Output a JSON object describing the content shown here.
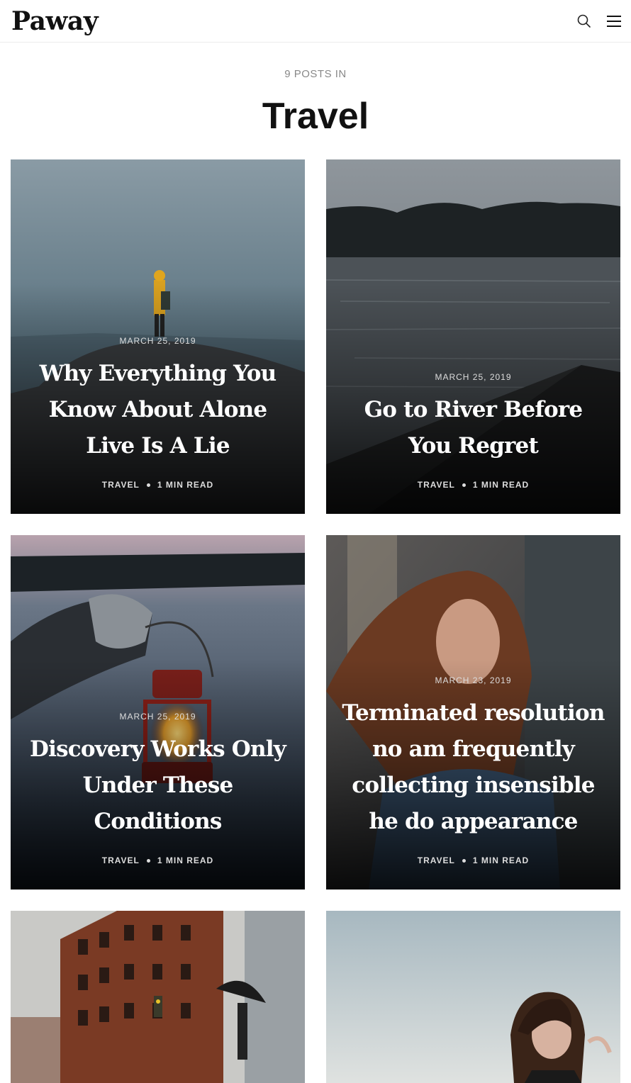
{
  "header": {
    "logo": "Paway",
    "search_icon": "search-icon",
    "menu_icon": "hamburger-menu-icon"
  },
  "archive": {
    "count_label": "9 POSTS IN",
    "title": "Travel"
  },
  "posts": [
    {
      "date": "MARCH 25, 2019",
      "title": "Why Everything You Know About Alone Live Is A Lie",
      "tag": "TRAVEL",
      "read_time": "1 MIN READ"
    },
    {
      "date": "MARCH 25, 2019",
      "title": "Go to River Before You Regret",
      "tag": "TRAVEL",
      "read_time": "1 MIN READ"
    },
    {
      "date": "MARCH 25, 2019",
      "title": "Discovery Works Only Under These Conditions",
      "tag": "TRAVEL",
      "read_time": "1 MIN READ"
    },
    {
      "date": "MARCH 23, 2019",
      "title": "Terminated resolution no am frequently collecting insensible he do appearance",
      "tag": "TRAVEL",
      "read_time": "1 MIN READ"
    }
  ]
}
